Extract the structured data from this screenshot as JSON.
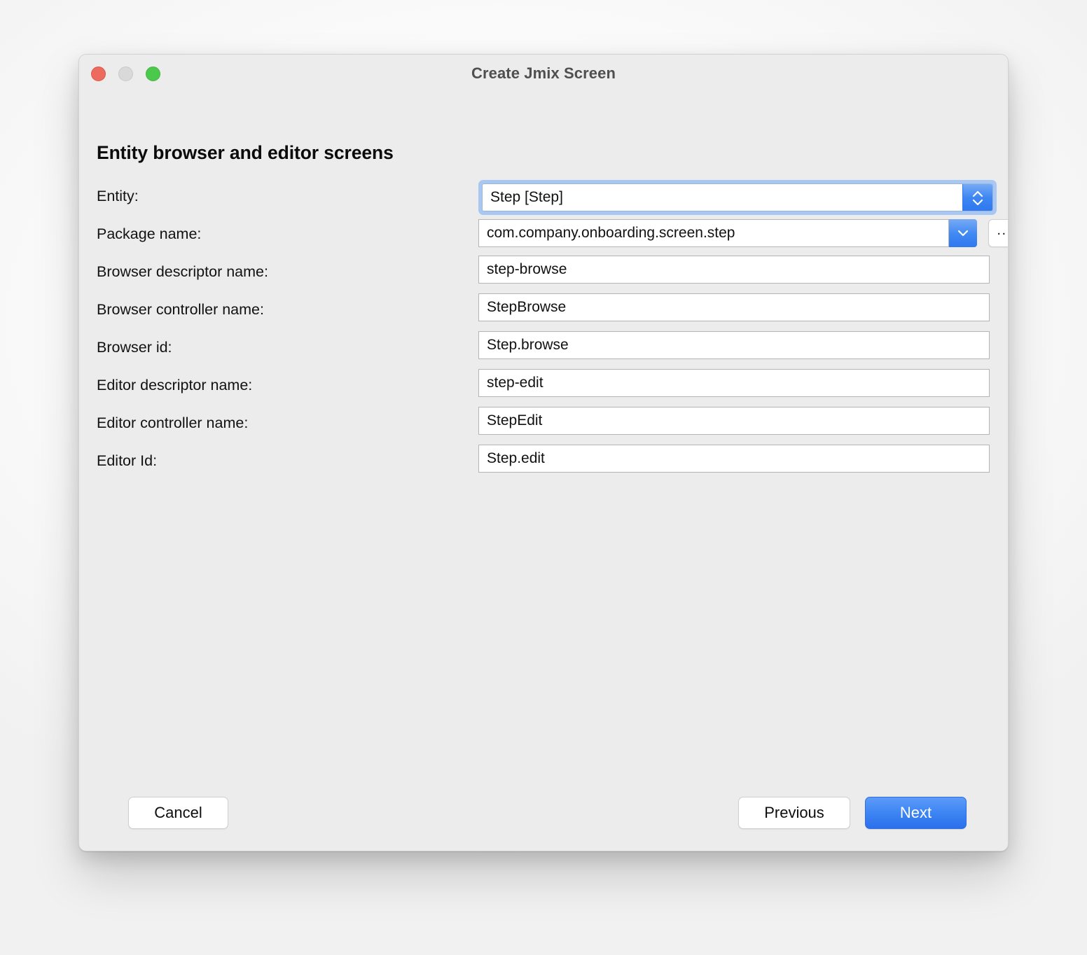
{
  "window": {
    "title": "Create Jmix Screen",
    "traffic_lights": {
      "close": "close-button",
      "minimize": "minimize-button",
      "maximize": "maximize-button"
    }
  },
  "heading": "Entity browser and editor screens",
  "form": {
    "rows": [
      {
        "label": "Entity:",
        "value": "Step [Step]",
        "kind": "stepper-combo"
      },
      {
        "label": "Package name:",
        "value": "com.company.onboarding.screen.step",
        "kind": "dropdown-combo",
        "browse_label": "..."
      },
      {
        "label": "Browser descriptor name:",
        "value": "step-browse",
        "kind": "text"
      },
      {
        "label": "Browser controller name:",
        "value": "StepBrowse",
        "kind": "text"
      },
      {
        "label": "Browser id:",
        "value": "Step.browse",
        "kind": "text"
      },
      {
        "label": "Editor descriptor name:",
        "value": "step-edit",
        "kind": "text"
      },
      {
        "label": "Editor controller name:",
        "value": "StepEdit",
        "kind": "text"
      },
      {
        "label": "Editor Id:",
        "value": "Step.edit",
        "kind": "text"
      }
    ]
  },
  "footer": {
    "cancel_label": "Cancel",
    "previous_label": "Previous",
    "next_label": "Next"
  },
  "colors": {
    "accent_blue": "#3e86f4",
    "focus_ring": "#a8c8f3",
    "window_bg": "#ececec",
    "traffic_close": "#ec6a5e",
    "traffic_min": "#d9d9d9",
    "traffic_max": "#4cc94c"
  }
}
